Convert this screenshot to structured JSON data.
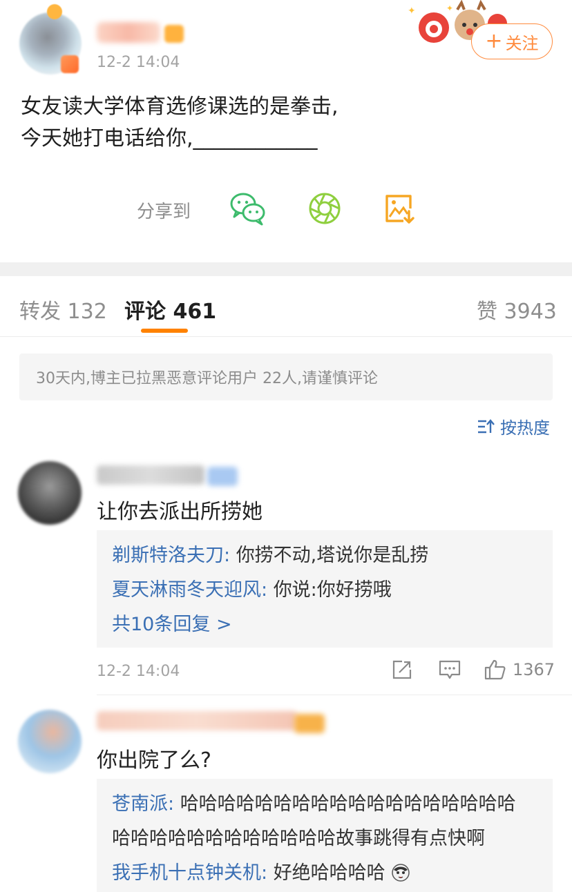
{
  "post": {
    "time": "12-2 14:04",
    "follow_label": "关注",
    "follow_plus": "+",
    "text_line1": "女友读大学体育选修课选的是拳击,",
    "text_line2": "今天她打电话给你,____________",
    "share_label": "分享到",
    "share_icons": [
      "wechat-icon",
      "moments-icon",
      "save-image-icon"
    ]
  },
  "tabs": {
    "repost": "转发 132",
    "comment": "评论 461",
    "like": "赞 3943"
  },
  "notice": "30天内,博主已拉黑恶意评论用户 22人,请谨慎评论",
  "sort_label": "按热度",
  "colors": {
    "accent": "#ff8200",
    "link": "#3a6fb4",
    "wechat": "#3dbb6c",
    "moments": "#8fcf3f",
    "save": "#f6a623"
  },
  "comments": [
    {
      "text": "让你去派出所捞她",
      "replies": [
        {
          "name": "剃斯特洛夫刀",
          "sep": ": ",
          "text": "你捞不动,塔说你是乱捞"
        },
        {
          "name": "夏天淋雨冬天迎风",
          "sep": ": ",
          "text": "你说:你好捞哦"
        }
      ],
      "more": "共10条回复 >",
      "time": "12-2 14:04",
      "likes": "1367"
    },
    {
      "text": "你出院了么?",
      "replies": [
        {
          "name": "苍南派",
          "sep": ": ",
          "text": "哈哈哈哈哈哈哈哈哈哈哈哈哈哈哈哈哈哈"
        },
        {
          "name": "",
          "sep": "",
          "text": "哈哈哈哈哈哈哈哈哈哈哈哈故事跳得有点快啊"
        },
        {
          "name": "我手机十点钟关机",
          "sep": ": ",
          "text": "好绝哈哈哈哈"
        }
      ]
    }
  ]
}
